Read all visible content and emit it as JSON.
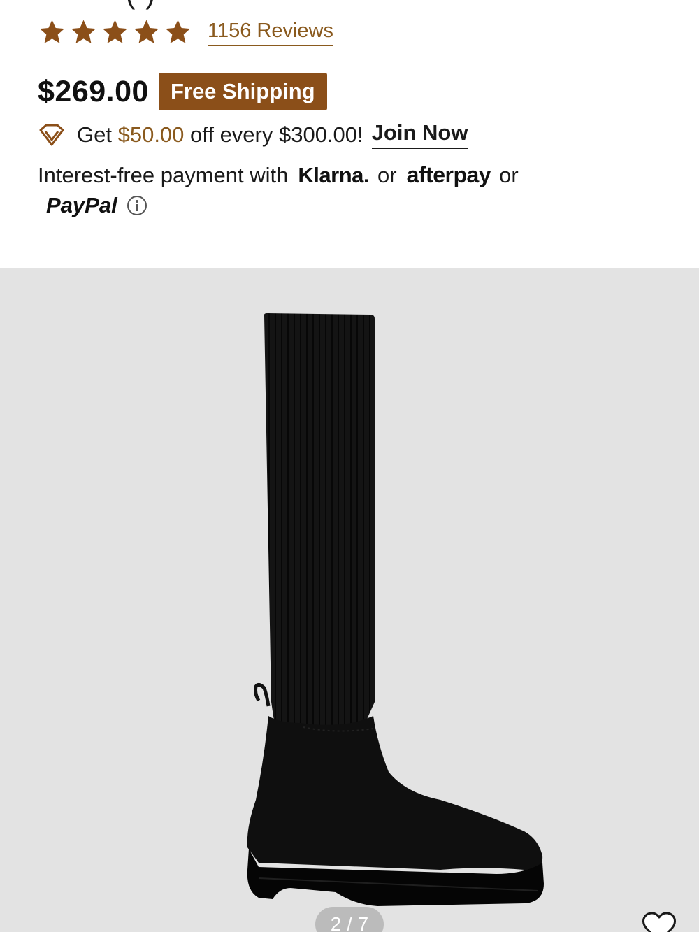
{
  "product": {
    "title_fragment": "(          )",
    "rating": {
      "stars_filled": 5,
      "stars_total": 5,
      "reviews_label": "1156 Reviews"
    },
    "price": "$269.00",
    "shipping_badge": "Free Shipping",
    "promo": {
      "prefix": "Get",
      "amount": "$50.00",
      "suffix": "off every $300.00!",
      "join_label": "Join Now"
    },
    "payment": {
      "intro": "Interest-free payment with",
      "klarna": "Klarna.",
      "or1": "or",
      "afterpay": "afterpay",
      "or2": "or",
      "paypal": "PayPal"
    }
  },
  "gallery": {
    "current": 2,
    "total": 7,
    "pager_label": "2 / 7",
    "image_alt": "Black knit knee-high sock boot with chunky lug sole"
  },
  "colors": {
    "accent_brown": "#8b4f19",
    "link_brown": "#8a5a1e",
    "gallery_bg": "#e3e3e3"
  },
  "icons": {
    "star": "star-icon",
    "diamond": "diamond-icon",
    "info": "info-icon",
    "favorite": "heart-icon"
  }
}
